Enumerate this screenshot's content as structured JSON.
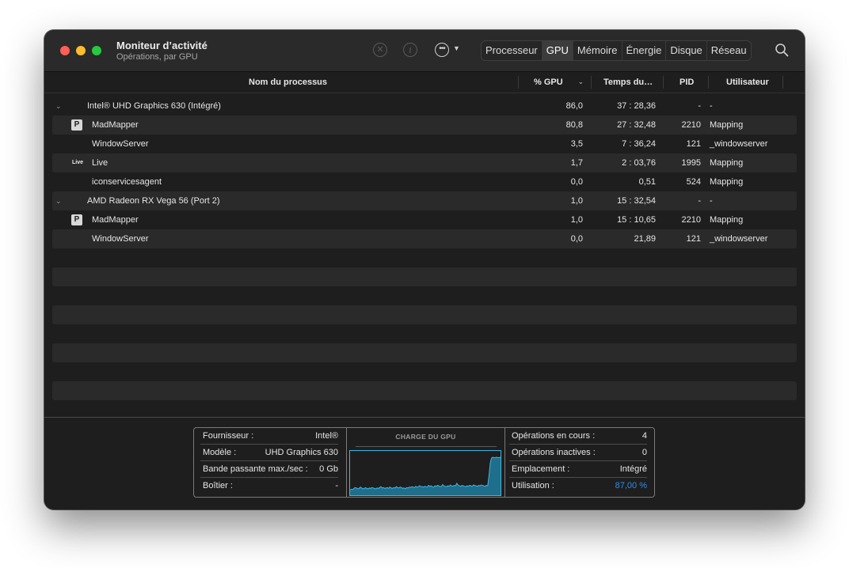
{
  "window": {
    "title": "Moniteur d’activité",
    "subtitle": "Opérations, par GPU"
  },
  "toolbar": {
    "stop_icon": "stop-process-icon",
    "info_icon": "info-icon",
    "more_icon": "ellipsis-icon",
    "tabs": [
      "Processeur",
      "GPU",
      "Mémoire",
      "Énergie",
      "Disque",
      "Réseau"
    ],
    "active_tab": "GPU",
    "search_icon": "search-icon"
  },
  "columns": {
    "name": "Nom du processus",
    "gpu": "% GPU",
    "time": "Temps du…",
    "pid": "PID",
    "user": "Utilisateur"
  },
  "rows": [
    {
      "kind": "group",
      "name": "Intel® UHD Graphics 630 (Intégré)",
      "gpu": "86,0",
      "time": "37 : 28,36",
      "pid": "-",
      "user": "-"
    },
    {
      "kind": "proc",
      "icon": "madmapper",
      "name": "MadMapper",
      "gpu": "80,8",
      "time": "27 : 32,48",
      "pid": "2210",
      "user": "Mapping"
    },
    {
      "kind": "proc",
      "icon": "",
      "name": "WindowServer",
      "gpu": "3,5",
      "time": "7 : 36,24",
      "pid": "121",
      "user": "_windowserver"
    },
    {
      "kind": "proc",
      "icon": "live",
      "name": "Live",
      "gpu": "1,7",
      "time": "2 : 03,76",
      "pid": "1995",
      "user": "Mapping"
    },
    {
      "kind": "proc",
      "icon": "",
      "name": "iconservicesagent",
      "gpu": "0,0",
      "time": "0,51",
      "pid": "524",
      "user": "Mapping"
    },
    {
      "kind": "group",
      "name": "AMD Radeon RX Vega 56 (Port 2)",
      "gpu": "1,0",
      "time": "15 : 32,54",
      "pid": "-",
      "user": "-"
    },
    {
      "kind": "proc",
      "icon": "madmapper",
      "name": "MadMapper",
      "gpu": "1,0",
      "time": "15 : 10,65",
      "pid": "2210",
      "user": "Mapping"
    },
    {
      "kind": "proc",
      "icon": "",
      "name": "WindowServer",
      "gpu": "0,0",
      "time": "21,89",
      "pid": "121",
      "user": "_windowserver"
    }
  ],
  "empty_rows": 8,
  "live_icon_text": "Live",
  "madmapper_icon_text": "P",
  "info_left": [
    {
      "k": "Fournisseur :",
      "v": "Intel®"
    },
    {
      "k": "Modèle :",
      "v": "UHD Graphics 630"
    },
    {
      "k": "Bande passante max./sec :",
      "v": "0 Gb"
    },
    {
      "k": "Boîtier :",
      "v": "-"
    }
  ],
  "info_right": [
    {
      "k": "Opérations en cours :",
      "v": "4"
    },
    {
      "k": "Opérations inactives :",
      "v": "0"
    },
    {
      "k": "Emplacement :",
      "v": "Intégré"
    },
    {
      "k": "Utilisation :",
      "v": "87,00 %",
      "accent": true
    }
  ],
  "chart_data": {
    "type": "area",
    "title": "CHARGE DU GPU",
    "ylim": [
      0,
      100
    ],
    "values": [
      12,
      14,
      13,
      16,
      18,
      17,
      15,
      16,
      19,
      17,
      15,
      16,
      18,
      16,
      15,
      17,
      16,
      18,
      17,
      16,
      15,
      17,
      16,
      18,
      20,
      17,
      18,
      16,
      17,
      18,
      16,
      19,
      17,
      16,
      18,
      17,
      20,
      18,
      17,
      19,
      18,
      16,
      17,
      15,
      18,
      17,
      19,
      18,
      20,
      19,
      18,
      21,
      19,
      20,
      22,
      21,
      20,
      19,
      21,
      20,
      19,
      23,
      21,
      22,
      20,
      19,
      22,
      21,
      23,
      22,
      20,
      21,
      25,
      22,
      21,
      20,
      22,
      21,
      24,
      22,
      21,
      23,
      22,
      28,
      24,
      22,
      21,
      23,
      22,
      21,
      20,
      22,
      21,
      23,
      22,
      21,
      24,
      23,
      22,
      21,
      23,
      22,
      24,
      23,
      22,
      21,
      23,
      22,
      45,
      75,
      87,
      89,
      88,
      88,
      89,
      88,
      88,
      89
    ],
    "fill_color": "#1f6e8c",
    "line_color": "#3fb6e0"
  },
  "colors": {
    "accent": "#2d8cf0",
    "close": "#fe5f57",
    "minimize": "#febc2e",
    "zoom": "#28c840"
  }
}
